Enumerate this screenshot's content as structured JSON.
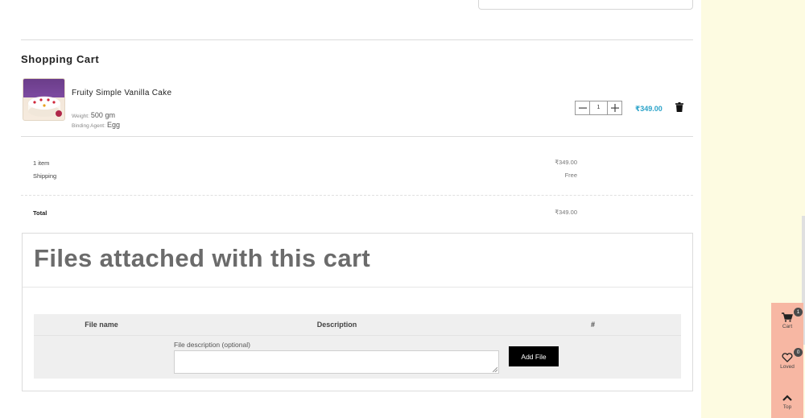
{
  "cart": {
    "title": "Shopping Cart",
    "item": {
      "name": "Fruity Simple Vanilla Cake",
      "weight_label": "Weight:",
      "weight_value": "500 gm",
      "agent_label": "Binding Agent:",
      "agent_value": "Egg",
      "quantity": "1",
      "price": "₹349.00",
      "image": "cake-image",
      "price_color": "#2ba3c9"
    },
    "summary": {
      "items_label": "1 item",
      "items_value": "₹349.00",
      "shipping_label": "Shipping",
      "shipping_value": "Free",
      "total_label": "Total",
      "total_value": "₹349.00"
    }
  },
  "files": {
    "title": "Files attached with this cart",
    "columns": [
      "File name",
      "Description",
      "#"
    ],
    "description_label": "File description (optional)",
    "description_value": "",
    "add_button": "Add File"
  },
  "side_rail": {
    "cart_label": "Cart",
    "cart_count": "1",
    "loved_label": "Loved",
    "loved_count": "0",
    "top_label": "Top",
    "color": "#f7b7a3"
  }
}
